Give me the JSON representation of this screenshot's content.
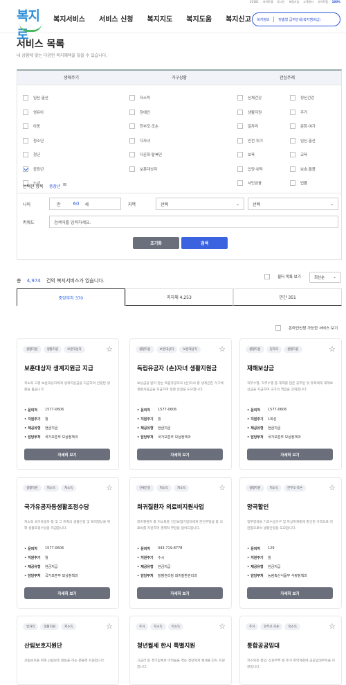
{
  "topbar": {
    "items": [
      "20181",
      "사이트맵",
      "로그인",
      "회원가입",
      "고객센터",
      "사이트맵",
      "100%"
    ]
  },
  "header": {
    "logo_text": "복지로",
    "nav": [
      "복지서비스",
      "서비스 신청",
      "복지지도",
      "복지도움",
      "복지신고"
    ],
    "btn_left": "복지정보",
    "btn_right": "맞춤형 급여안내(복지멤버십)"
  },
  "page": {
    "title": "서비스 목록",
    "subtitle": "내 상황에 맞는 다양한 복지혜택을 찾을 수 있습니다."
  },
  "filter": {
    "headers": [
      "생애주기",
      "가구상황",
      "관심주제"
    ],
    "life": [
      "임신·출산",
      "영유아",
      "아동",
      "청소년",
      "청년",
      "중장년",
      "노년"
    ],
    "life_checked": [
      5
    ],
    "house": [
      "저소득",
      "장애인",
      "한부모·조손",
      "다자녀",
      "다문화·탈북민",
      "보훈대상자"
    ],
    "topic_left": [
      "신체건강",
      "생활지원",
      "일자리",
      "안전·위기",
      "보육",
      "입양·위탁",
      "서민금융"
    ],
    "topic_right": [
      "정신건강",
      "주거",
      "문화·여가",
      "임신·출산",
      "교육",
      "보호·돌봄",
      "법률"
    ],
    "selected_label": "선택한 항목",
    "selected_value": "중장년",
    "age_label": "나이",
    "age_prefix": "만",
    "age_value": "60",
    "age_unit": "세",
    "region_label": "지역",
    "region_sel1": "선택",
    "region_sel2": "선택",
    "keyword_label": "키워드",
    "keyword_placeholder": "검색어를 입력하세요.",
    "reset": "초기화",
    "search": "검색"
  },
  "results": {
    "prefix": "총",
    "count": "4,974",
    "suffix": "건의 복지서비스가 있습니다.",
    "viewall": "필터 목록 보기",
    "sort": "최신순"
  },
  "tabs": [
    {
      "label": "중앙부처 370"
    },
    {
      "label": "지자체 4,253"
    },
    {
      "label": "민간 351"
    }
  ],
  "online_label": "온라인신청 가능한 서비스 보기",
  "cards": [
    {
      "tags": [
        "생활지원",
        "생활지원",
        "보훈대상자"
      ],
      "title": "보훈대상자 생계지원금 지급",
      "desc": "저소득 고령 보훈대상자에게 생계지원금을 지급하여 안정된 생활을 돕습니다.",
      "phone": "1577-0606",
      "cycle": "월",
      "type": "현금지급",
      "dept": "국가보훈부 보상정책과"
    },
    {
      "tags": [
        "생활지원",
        "보훈대상자",
        "보훈대상자"
      ],
      "title": "독립유공자 (손)자녀 생활지원금",
      "desc": "보상금을 받지 않는 독립유공자의 (손)자녀 중 생계곤란 가구에 생활지원금을 지급하여 생활 안정을 도모합니다.",
      "phone": "1577-0606",
      "cycle": "월",
      "type": "현금지급",
      "dept": "국가보훈부 보상정책과"
    },
    {
      "tags": [
        "생활지원",
        "일자리",
        "생활지원"
      ],
      "title": "재해보상금",
      "desc": "직무수행, 직무수행 중 재해를 입은 공무원 및 유족에게 재해보상금을 지급하여 국가의 책임을 강화합니다.",
      "phone": "1577-0606",
      "cycle": "1회성",
      "type": "현금지급",
      "dept": "국가보훈부 보상정책과"
    },
    {
      "tags": [
        "생활지원",
        "저소득",
        "저소득"
      ],
      "title": "국가유공자등생활조정수당",
      "desc": "저소득 국가유공자 등 및 그 유족의 생활안정 및 복지향상을 위해 생활조정수당을 지급합니다.",
      "phone": "1577-0606",
      "cycle": "월",
      "type": "현금지급",
      "dept": "국가보훈부 보상정책과"
    },
    {
      "tags": [
        "신체건강",
        "저소득",
        "저소득"
      ],
      "title": "희귀질환자 의료비지원사업",
      "desc": "희귀질환자 중 저소득층 건강보험가입자에게 본인부담금 등 의료비를 지원하여 경제적 부담을 덜어드립니다.",
      "phone": "043-719-8778",
      "cycle": "수시",
      "type": "현금지급",
      "dept": "질병관리청 희귀질환관리과"
    },
    {
      "tags": [
        "생활지원",
        "저소득",
        "한부모·조손"
      ],
      "title": "양곡할인",
      "desc": "정부양곡을 기초수급가구 및 차상위계층에 할인된 가격으로 지원함으로써 생활안정을 도모합니다.",
      "phone": "129",
      "cycle": "월",
      "type": "현금지급",
      "dept": "농림축산식품부 식량정책과"
    },
    {
      "tags": [
        "일자리",
        "생활지원",
        "저소득"
      ],
      "title": "산림보호지원단",
      "desc": "산림보호를 위해 산림보호 활동을 하는 분들께 지원합니다.",
      "phone": "",
      "cycle": "",
      "type": "",
      "dept": ""
    },
    {
      "tags": [
        "주거",
        "저소득",
        "저소득"
      ],
      "title": "청년월세 한시 특별지원",
      "desc": "고금리 등 경기침체로 어려움을 겪는 청년에게 월세를 한시 지원합니다.",
      "phone": "",
      "cycle": "",
      "type": "",
      "dept": ""
    },
    {
      "tags": [
        "주거",
        "한부모·조손",
        "저소득"
      ],
      "title": "통합공공임대",
      "desc": "저소득층 청년, 신혼부부 등 주거 취약계층에 공공임대주택을 지원합니다.",
      "phone": "",
      "cycle": "",
      "type": "",
      "dept": ""
    }
  ],
  "card_labels": {
    "phone": "문의처",
    "cycle": "지원주기",
    "type": "제공유형",
    "dept": "담당부처",
    "detail": "자세히 보기"
  }
}
